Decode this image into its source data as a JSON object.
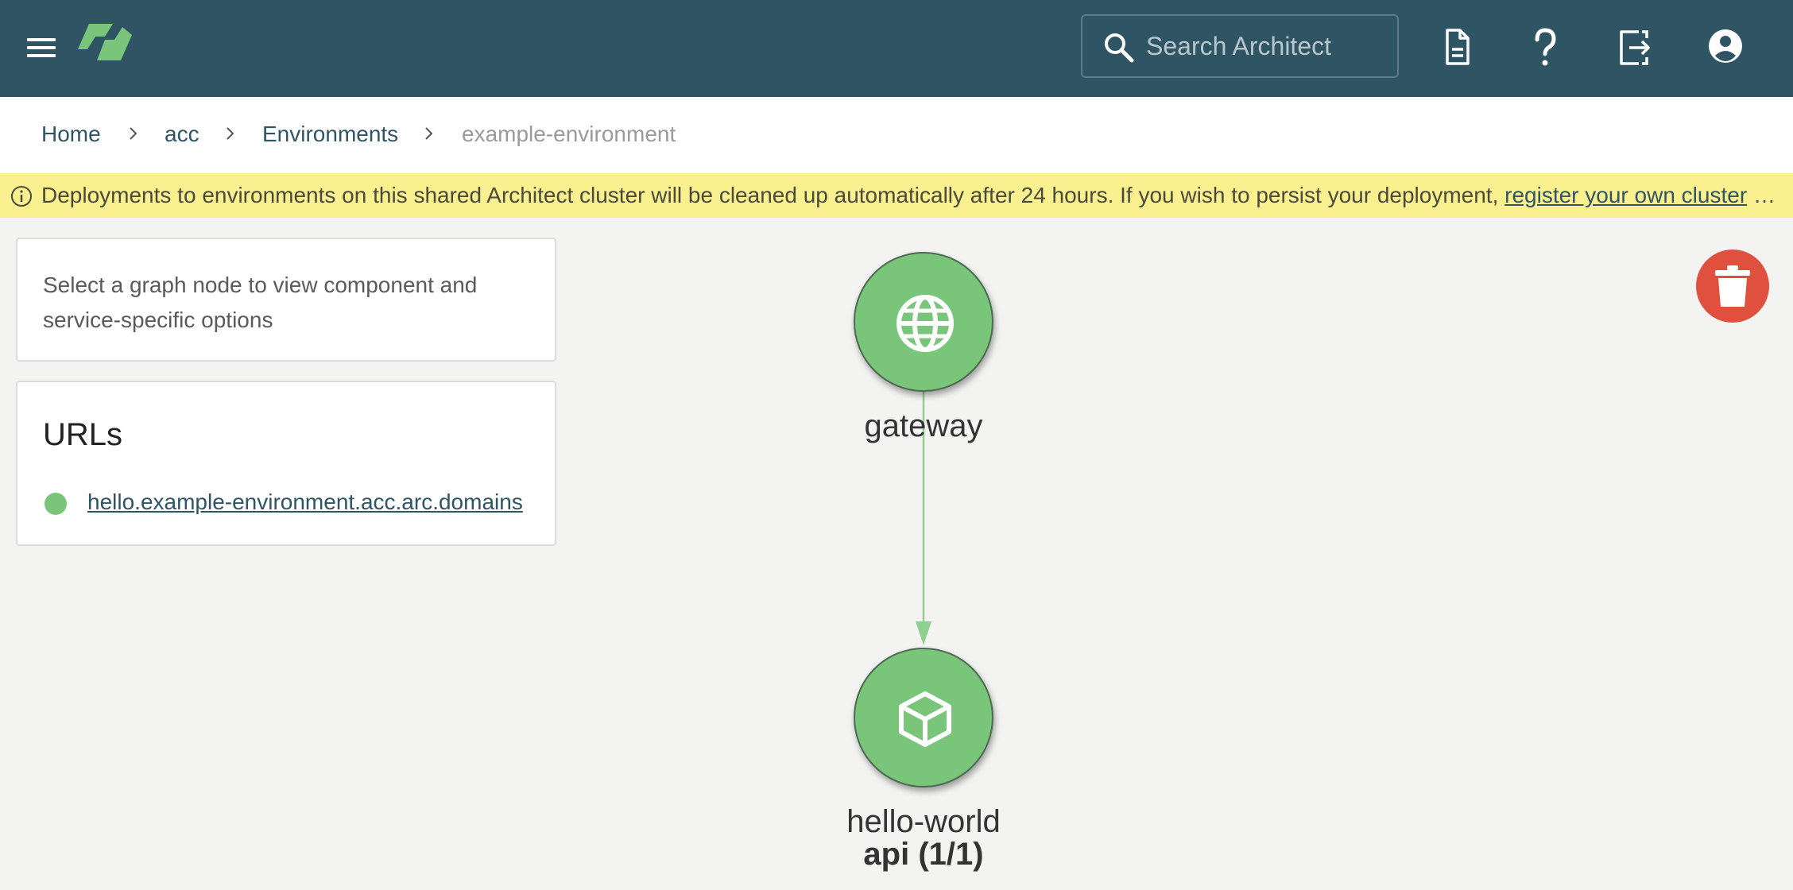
{
  "header": {
    "menu_icon": "hamburger-menu-icon",
    "logo_icon": "architect-logo-icon",
    "search_placeholder": "Search Architect",
    "icons": [
      "document-icon",
      "help-icon",
      "logout-icon",
      "account-icon"
    ]
  },
  "breadcrumb": {
    "items": [
      "Home",
      "acc",
      "Environments",
      "example-environment"
    ]
  },
  "banner": {
    "text": "Deployments to environments on this shared Architect cluster will be cleaned up automatically after 24 hours. If you wish to persist your deployment,",
    "link": "register your own cluster",
    "ellipsis": "…"
  },
  "panel_hint": {
    "text": "Select a graph node to view component and service-specific options"
  },
  "urls_panel": {
    "title": "URLs",
    "items": [
      {
        "url": "hello.example-environment.acc.arc.domains",
        "status_color": "#79c57a"
      }
    ]
  },
  "graph": {
    "nodes": [
      {
        "label": "gateway",
        "icon": "globe-icon"
      },
      {
        "label": "hello-world",
        "sublabel": "api (1/1)",
        "icon": "cube-icon"
      }
    ],
    "edges": [
      {
        "from": "gateway",
        "to": "hello-world"
      }
    ]
  },
  "colors": {
    "header_bg": "#2f5463",
    "banner_bg": "#faf08f",
    "node_fill": "#79c57a",
    "delete_button": "#e0503f"
  },
  "delete_icon": "trash-icon"
}
